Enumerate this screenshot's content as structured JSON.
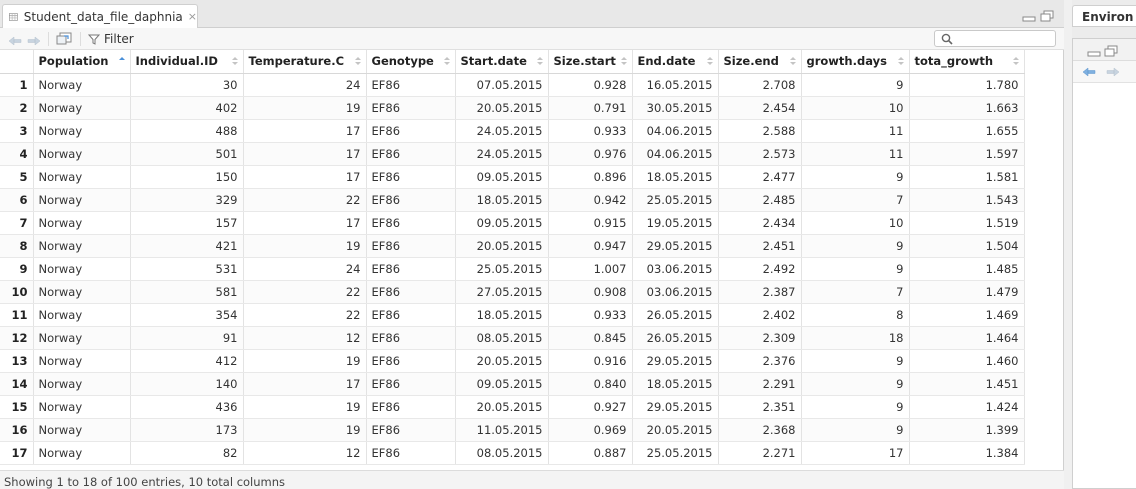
{
  "tab": {
    "title": "Student_data_file_daphnia",
    "close": "×"
  },
  "toolbar": {
    "filter_label": "Filter",
    "search_value": ""
  },
  "table": {
    "columns": [
      "Population",
      "Individual.ID",
      "Temperature.C",
      "Genotype",
      "Start.date",
      "Size.start",
      "End.date",
      "Size.end",
      "growth.days",
      "tota_growth"
    ],
    "rows": [
      [
        "1",
        "Norway",
        "30",
        "24",
        "EF86",
        "07.05.2015",
        "0.928",
        "16.05.2015",
        "2.708",
        "9",
        "1.780"
      ],
      [
        "2",
        "Norway",
        "402",
        "19",
        "EF86",
        "20.05.2015",
        "0.791",
        "30.05.2015",
        "2.454",
        "10",
        "1.663"
      ],
      [
        "3",
        "Norway",
        "488",
        "17",
        "EF86",
        "24.05.2015",
        "0.933",
        "04.06.2015",
        "2.588",
        "11",
        "1.655"
      ],
      [
        "4",
        "Norway",
        "501",
        "17",
        "EF86",
        "24.05.2015",
        "0.976",
        "04.06.2015",
        "2.573",
        "11",
        "1.597"
      ],
      [
        "5",
        "Norway",
        "150",
        "17",
        "EF86",
        "09.05.2015",
        "0.896",
        "18.05.2015",
        "2.477",
        "9",
        "1.581"
      ],
      [
        "6",
        "Norway",
        "329",
        "22",
        "EF86",
        "18.05.2015",
        "0.942",
        "25.05.2015",
        "2.485",
        "7",
        "1.543"
      ],
      [
        "7",
        "Norway",
        "157",
        "17",
        "EF86",
        "09.05.2015",
        "0.915",
        "19.05.2015",
        "2.434",
        "10",
        "1.519"
      ],
      [
        "8",
        "Norway",
        "421",
        "19",
        "EF86",
        "20.05.2015",
        "0.947",
        "29.05.2015",
        "2.451",
        "9",
        "1.504"
      ],
      [
        "9",
        "Norway",
        "531",
        "24",
        "EF86",
        "25.05.2015",
        "1.007",
        "03.06.2015",
        "2.492",
        "9",
        "1.485"
      ],
      [
        "10",
        "Norway",
        "581",
        "22",
        "EF86",
        "27.05.2015",
        "0.908",
        "03.06.2015",
        "2.387",
        "7",
        "1.479"
      ],
      [
        "11",
        "Norway",
        "354",
        "22",
        "EF86",
        "18.05.2015",
        "0.933",
        "26.05.2015",
        "2.402",
        "8",
        "1.469"
      ],
      [
        "12",
        "Norway",
        "91",
        "12",
        "EF86",
        "08.05.2015",
        "0.845",
        "26.05.2015",
        "2.309",
        "18",
        "1.464"
      ],
      [
        "13",
        "Norway",
        "412",
        "19",
        "EF86",
        "20.05.2015",
        "0.916",
        "29.05.2015",
        "2.376",
        "9",
        "1.460"
      ],
      [
        "14",
        "Norway",
        "140",
        "17",
        "EF86",
        "09.05.2015",
        "0.840",
        "18.05.2015",
        "2.291",
        "9",
        "1.451"
      ],
      [
        "15",
        "Norway",
        "436",
        "19",
        "EF86",
        "20.05.2015",
        "0.927",
        "29.05.2015",
        "2.351",
        "9",
        "1.424"
      ],
      [
        "16",
        "Norway",
        "173",
        "19",
        "EF86",
        "11.05.2015",
        "0.969",
        "20.05.2015",
        "2.368",
        "9",
        "1.399"
      ],
      [
        "17",
        "Norway",
        "82",
        "12",
        "EF86",
        "08.05.2015",
        "0.887",
        "25.05.2015",
        "2.271",
        "17",
        "1.384"
      ]
    ]
  },
  "status": {
    "text": "Showing 1 to 18 of 100 entries, 10 total columns"
  },
  "right_pane": {
    "tab_label": "Environ"
  },
  "colors": {
    "accent": "#4a90d9",
    "border": "#d0d0d0"
  }
}
